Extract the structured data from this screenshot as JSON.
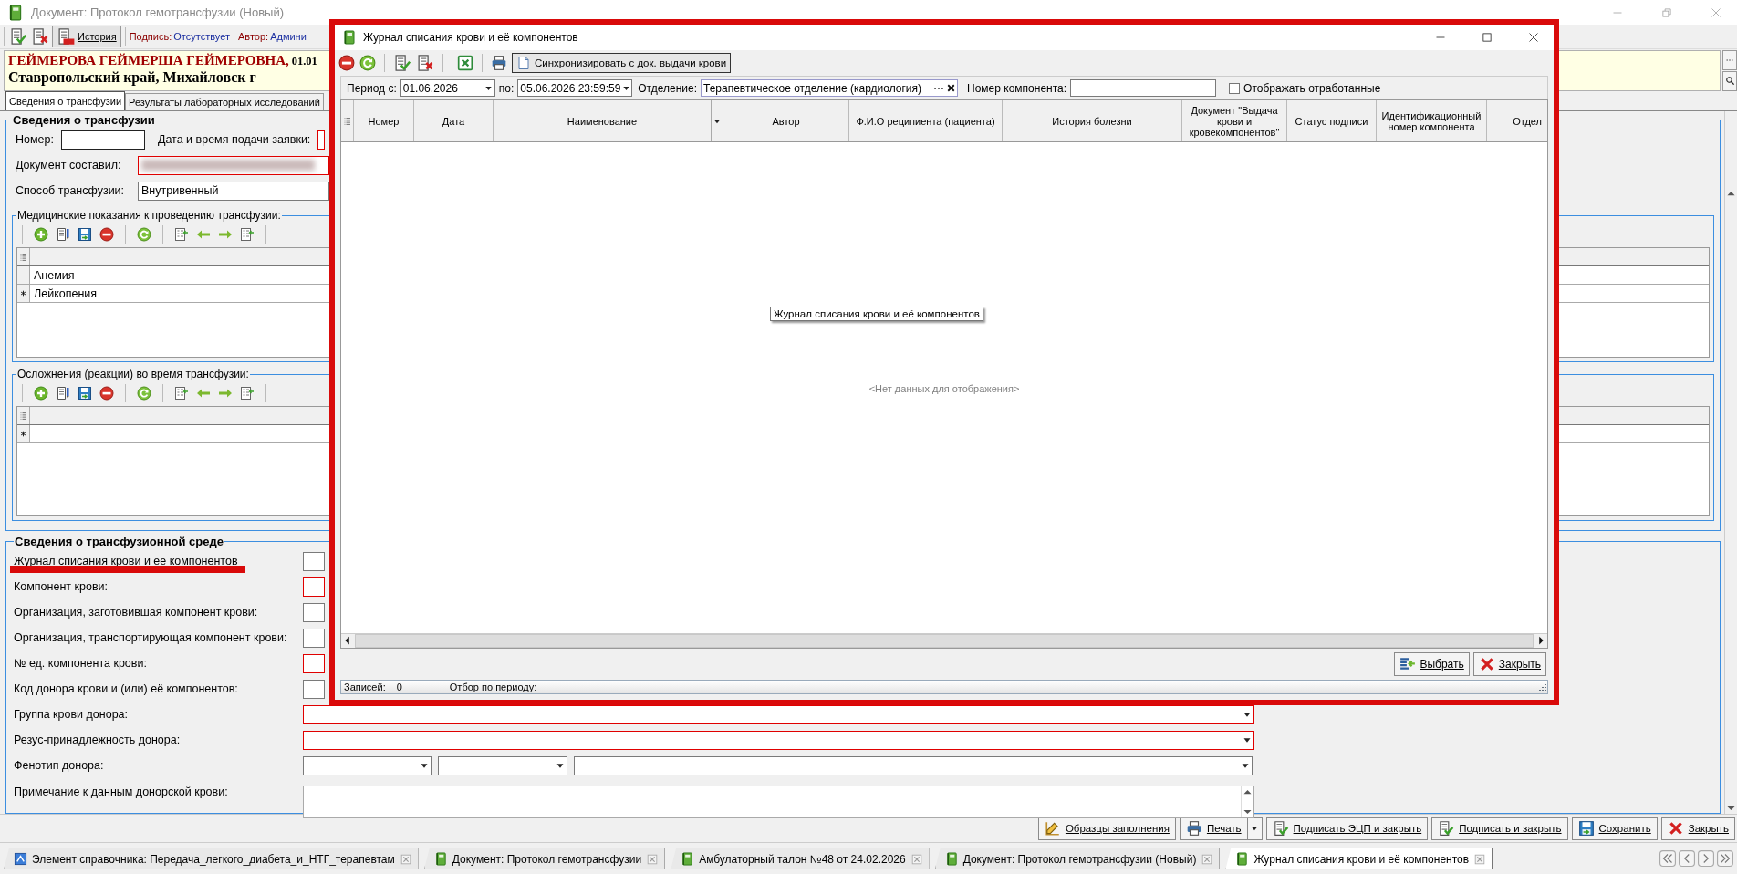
{
  "main_window": {
    "title": "Документ: Протокол гемотрансфузии (Новый)",
    "toolbar": {
      "history_button": "История",
      "signature_label": "Подпись:",
      "signature_value": "Отсутствует",
      "author_label": "Автор:",
      "author_value": "Админи"
    },
    "patient": {
      "name": "ГЕЙМЕРОВА ГЕЙМЕРША ГЕЙМЕРОВНА,",
      "birth_date": "01.01",
      "address": "Ставропольский край, Михайловск г"
    },
    "tabs": [
      {
        "label": "Сведения о трансфузии",
        "selected": true
      },
      {
        "label": "Результаты лабораторных исследований",
        "selected": false
      }
    ],
    "transfusion_info": {
      "title": "Сведения о трансфузии",
      "number_label": "Номер:",
      "request_date_label": "Дата и время подачи заявки:",
      "author_label": "Документ составил:",
      "method_label": "Способ трансфузии:",
      "method_value": "Внутривенный"
    },
    "indications": {
      "title": "Медицинские показания к проведению трансфузии:",
      "rows": [
        {
          "text": "Анемия",
          "new_row": false
        },
        {
          "text": "Лейкопения",
          "new_row": true
        }
      ]
    },
    "complications": {
      "title": "Осложнения (реакции) во время трансфузии:"
    },
    "environment": {
      "title": "Сведения о трансфузионной среде",
      "fields": [
        {
          "label": "Журнал списания крови и ее компонентов",
          "kind": "text",
          "required": false,
          "highlighted": true
        },
        {
          "label": "Компонент крови:",
          "kind": "text",
          "required": true,
          "highlighted": false
        },
        {
          "label": "Организация, заготовившая компонент крови:",
          "kind": "text",
          "required": false,
          "highlighted": false
        },
        {
          "label": "Организация, транспортирующая компонент крови:",
          "kind": "text",
          "required": false,
          "highlighted": false
        },
        {
          "label": "№ ед. компонента крови:",
          "kind": "text",
          "required": true,
          "highlighted": false
        },
        {
          "label": "Код донора крови и (или) её компонентов:",
          "kind": "text",
          "required": false,
          "highlighted": false
        },
        {
          "label": "Группа крови донора:",
          "kind": "dropdown",
          "required": true,
          "highlighted": false
        },
        {
          "label": "Резус-принадлежность донора:",
          "kind": "dropdown",
          "required": true,
          "highlighted": false
        },
        {
          "label": "Фенотип донора:",
          "kind": "triple",
          "required": false,
          "highlighted": false
        },
        {
          "label": "Примечание к данным донорской крови:",
          "kind": "memo",
          "required": false,
          "highlighted": false
        }
      ]
    },
    "buttons": [
      {
        "label": "Образцы заполнения",
        "kind": "samples"
      },
      {
        "label": "Печать",
        "kind": "print"
      },
      {
        "label": "Подписать ЭЦП и закрыть",
        "kind": "sign"
      },
      {
        "label": "Подписать и закрыть",
        "kind": "sign"
      },
      {
        "label": "Сохранить",
        "kind": "save"
      },
      {
        "label": "Закрыть",
        "kind": "close"
      }
    ]
  },
  "dialog": {
    "title": "Журнал списания крови и её компонентов",
    "sync_button": "Синхронизировать с док. выдачи крови",
    "filter": {
      "period_from_label": "Период с:",
      "period_from": "01.06.2026",
      "period_to_label": "по:",
      "period_to": "05.06.2026 23:59:59",
      "department_label": "Отделение:",
      "department": "Терапевтическое отделение (кардиология)",
      "component_label": "Номер компонента:",
      "show_processed": {
        "label": "Отображать отработанные",
        "checked": false
      }
    },
    "table": {
      "columns": [
        "Номер",
        "Дата",
        "Наименование",
        "Автор",
        "Ф.И.О реципиента (пациента)",
        "История болезни",
        "Документ \"Выдача крови и кровекомпонентов\"",
        "Статус подписи",
        "Идентификационный номер компонента",
        "Отдел"
      ],
      "empty_text": "<Нет данных для отображения>"
    },
    "tooltip": "Журнал списания крови и её компонентов",
    "buttons": [
      {
        "label": "Выбрать",
        "kind": "select"
      },
      {
        "label": "Закрыть",
        "kind": "close"
      }
    ],
    "status_bar": {
      "records_label": "Записей:",
      "records": "0",
      "period_label": "Отбор по периоду:"
    }
  },
  "taskbar": [
    {
      "label": "Элемент справочника: Передача_легкого_диабета_и_НТГ_терапевтам",
      "kind": "reference",
      "selected": false
    },
    {
      "label": "Документ: Протокол гемотрансфузии",
      "kind": "document",
      "selected": false
    },
    {
      "label": "Амбулаторный талон №48 от 24.02.2026",
      "kind": "document",
      "selected": false
    },
    {
      "label": "Документ: Протокол гемотрансфузии (Новый)",
      "kind": "document",
      "selected": false
    },
    {
      "label": "Журнал списания крови и её компонентов",
      "kind": "document",
      "selected": true
    }
  ]
}
